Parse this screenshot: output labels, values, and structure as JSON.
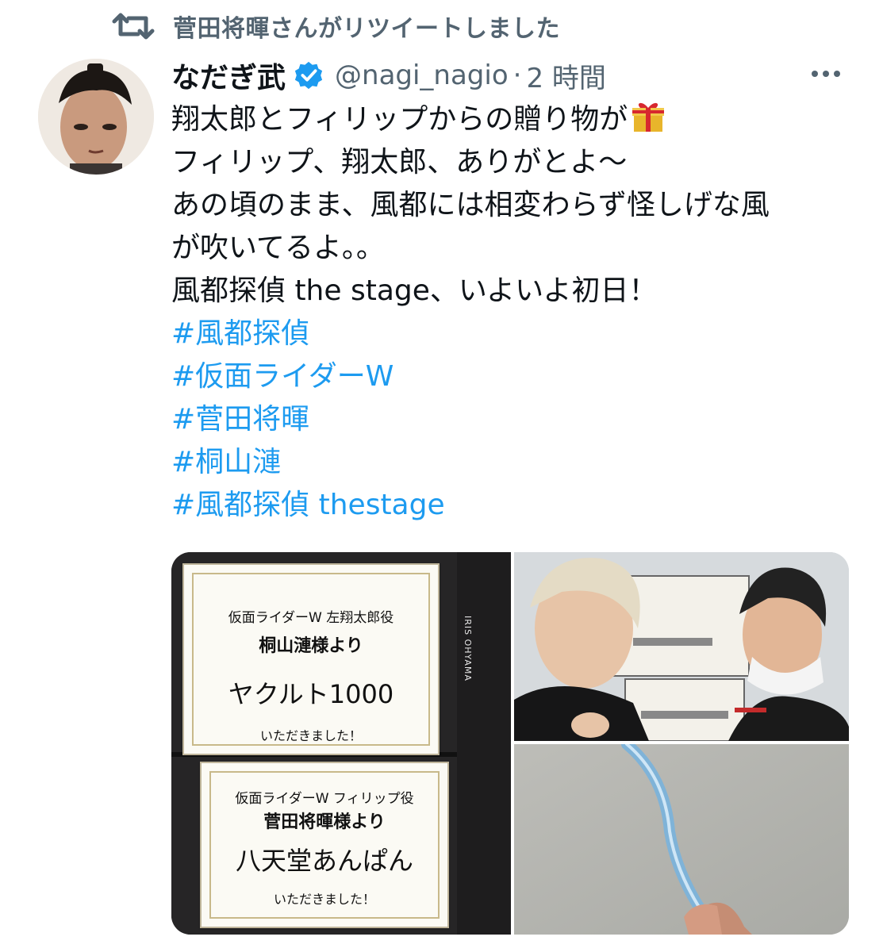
{
  "retweet": {
    "icon": "retweet-icon",
    "text": "菅田将暉さんがリツイートしました"
  },
  "tweet": {
    "display_name": "なだぎ武",
    "verified_icon": "verified-badge-icon",
    "handle": "@nagi_nagio",
    "separator": "·",
    "time": "2 時間",
    "lines": [
      "翔太郎とフィリップからの贈り物が",
      "フィリップ、翔太郎、ありがとよ〜",
      "あの頃のまま、風都には相変わらず怪しげな風",
      "が吹いてるよ。。",
      "風都探偵 the stage、いよいよ初日！"
    ],
    "gift_emoji": "gift-icon",
    "hashtags": [
      "#風都探偵",
      "#仮面ライダーW",
      "#菅田将暉",
      "#桐山漣",
      "#風都探偵 thestage"
    ],
    "colors": {
      "link": "#1d9bf0",
      "secondary": "#536471",
      "verified": "#1d9bf0"
    }
  },
  "media": {
    "note1": {
      "role": "仮面ライダーW 左翔太郎役",
      "from": "桐山漣様より",
      "gift": "ヤクルト1000",
      "thanks": "いただきました！"
    },
    "note2": {
      "role": "仮面ライダーW フィリップ役",
      "from": "菅田将暉様より",
      "gift": "八天堂あんぱん",
      "thanks": "いただきました！"
    },
    "fridge_brand": "IRIS OHYAMA"
  }
}
